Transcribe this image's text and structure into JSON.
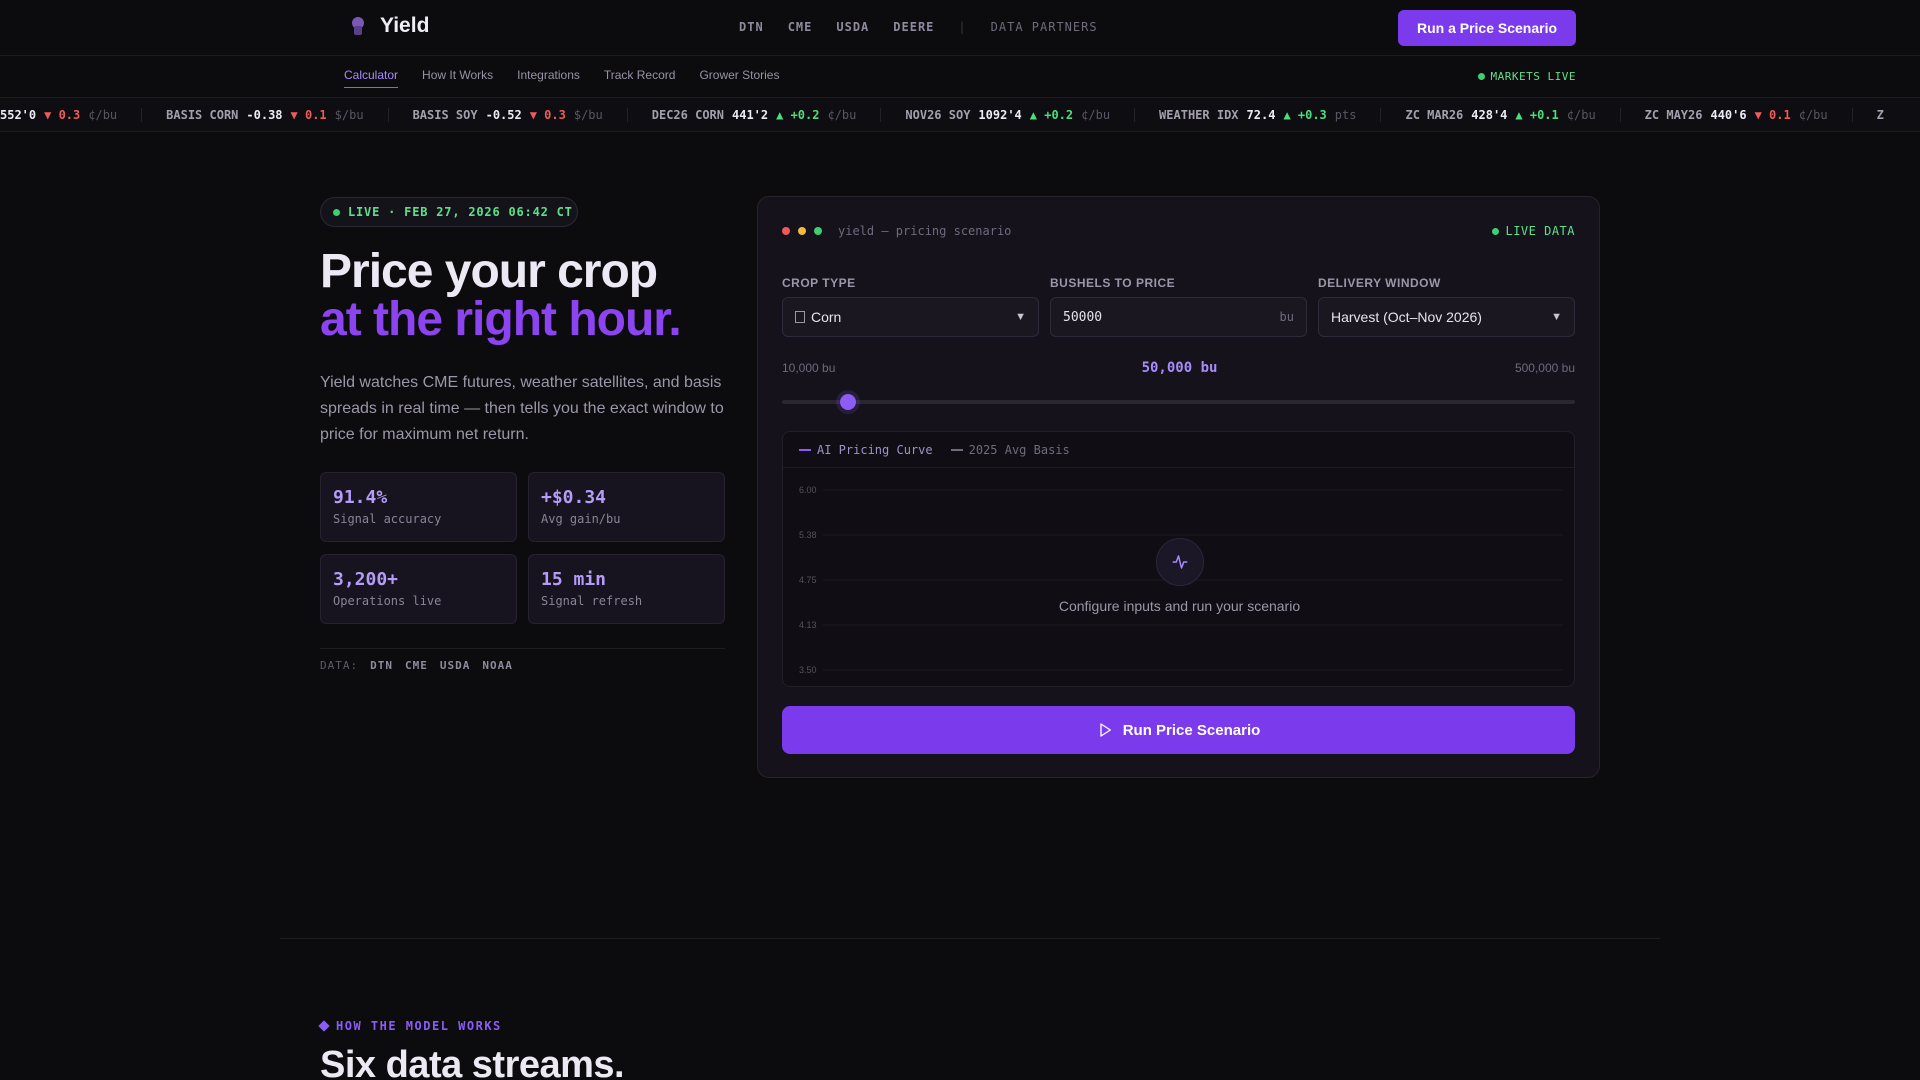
{
  "brand": {
    "name": "Yield"
  },
  "topnav": {
    "links": [
      "DTN",
      "CME",
      "USDA",
      "DEERE"
    ],
    "separator": "|",
    "partners_label": "DATA PARTNERS",
    "cta_label": "Run a Price Scenario"
  },
  "subnav": {
    "tabs": [
      "Calculator",
      "How It Works",
      "Integrations",
      "Track Record",
      "Grower Stories"
    ],
    "active_tab": "Calculator",
    "markets_status": "MARKETS LIVE"
  },
  "ticker": [
    {
      "sym": "",
      "val": "552'0",
      "dir": "down",
      "chg": "0.3",
      "unit": "¢/bu"
    },
    {
      "sym": "BASIS CORN",
      "val": "-0.38",
      "dir": "down",
      "chg": "0.1",
      "unit": "$/bu"
    },
    {
      "sym": "BASIS SOY",
      "val": "-0.52",
      "dir": "down",
      "chg": "0.3",
      "unit": "$/bu"
    },
    {
      "sym": "DEC26 CORN",
      "val": "441'2",
      "dir": "up",
      "chg": "+0.2",
      "unit": "¢/bu"
    },
    {
      "sym": "NOV26 SOY",
      "val": "1092'4",
      "dir": "up",
      "chg": "+0.2",
      "unit": "¢/bu"
    },
    {
      "sym": "WEATHER IDX",
      "val": "72.4",
      "dir": "up",
      "chg": "+0.3",
      "unit": "pts"
    },
    {
      "sym": "ZC MAR26",
      "val": "428'4",
      "dir": "up",
      "chg": "+0.1",
      "unit": "¢/bu"
    },
    {
      "sym": "ZC MAY26",
      "val": "440'6",
      "dir": "down",
      "chg": "0.1",
      "unit": "¢/bu"
    },
    {
      "sym": "Z",
      "val": "",
      "dir": "",
      "chg": "",
      "unit": ""
    }
  ],
  "hero": {
    "live_badge": "LIVE · FEB 27, 2026 06:42 CT",
    "title_line1": "Price your crop",
    "title_line2": "at the right hour.",
    "description": "Yield watches CME futures, weather satellites, and basis spreads in real time — then tells you the exact window to price for maximum net return.",
    "stats": [
      {
        "value": "91.4%",
        "label": "Signal accuracy"
      },
      {
        "value": "+$0.34",
        "label": "Avg gain/bu"
      },
      {
        "value": "3,200+",
        "label": "Operations live"
      },
      {
        "value": "15 min",
        "label": "Signal refresh"
      }
    ],
    "data_label": "DATA:",
    "data_sources": [
      "DTN",
      "CME",
      "USDA",
      "NOAA"
    ]
  },
  "calculator": {
    "window_title": "yield — pricing scenario",
    "live_label": "LIVE DATA",
    "crop_type": {
      "label": "CROP TYPE",
      "value": "Corn"
    },
    "bushels": {
      "label": "BUSHELS TO PRICE",
      "value": "50000",
      "unit": "bu"
    },
    "delivery": {
      "label": "DELIVERY WINDOW",
      "value": "Harvest (Oct–Nov 2026)"
    },
    "slider": {
      "min_label": "10,000 bu",
      "value_label": "50,000 bu",
      "max_label": "500,000 bu",
      "min": 10000,
      "max": 500000,
      "value": 50000
    },
    "legend": {
      "series1": "AI Pricing Curve",
      "series2": "2025 Avg Basis"
    },
    "y_ticks": [
      "6.00",
      "5.38",
      "4.75",
      "4.13",
      "3.50"
    ],
    "empty_text": "Configure inputs and run your scenario",
    "run_label": "Run Price Scenario"
  },
  "colors": {
    "accent": "#7c3aed",
    "accent_light": "#a78bfa",
    "up": "#4ade80",
    "down": "#ef5a5a",
    "live": "#3ecf72"
  },
  "section": {
    "tag": "HOW THE MODEL WORKS",
    "title": "Six data streams."
  }
}
